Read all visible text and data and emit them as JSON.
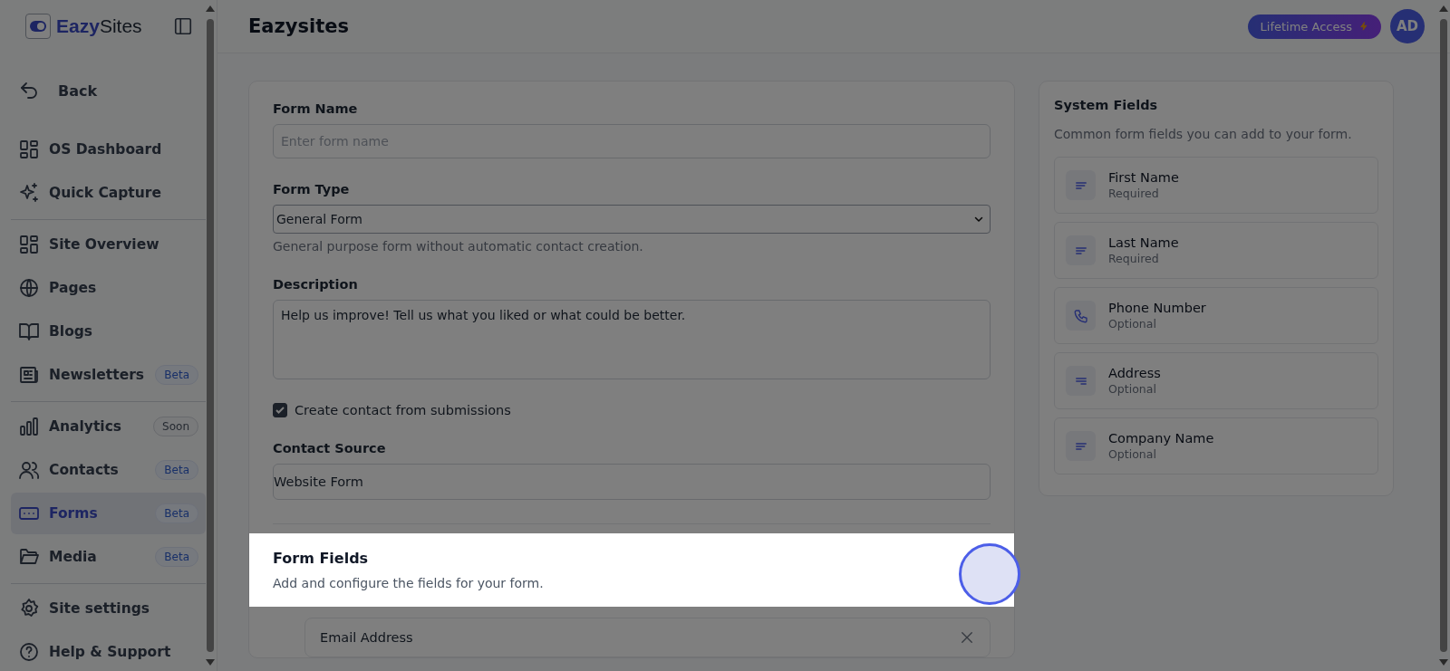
{
  "sidebar": {
    "logo": "**Eazy**Sites",
    "back": "Back",
    "groups": [
      {
        "items": [
          {
            "label": "OS Dashboard",
            "selected": false
          },
          {
            "label": "Quick Capture",
            "selected": false
          }
        ]
      },
      {
        "items": [
          {
            "label": "Site Overview",
            "selected": false
          },
          {
            "label": "Pages",
            "selected": false
          },
          {
            "label": "Blogs",
            "selected": false
          },
          {
            "label": "Newsletters",
            "selected": false,
            "badge": {
              "text": "Beta",
              "kind": "beta"
            }
          }
        ]
      },
      {
        "items": [
          {
            "label": "Analytics",
            "selected": false,
            "badge": {
              "text": "Soon",
              "kind": "soon"
            }
          },
          {
            "label": "Contacts",
            "selected": false,
            "badge": {
              "text": "Beta",
              "kind": "beta"
            }
          },
          {
            "label": "Forms",
            "selected": true,
            "badge": {
              "text": "Beta",
              "kind": "beta"
            }
          },
          {
            "label": "Media",
            "selected": false,
            "badge": {
              "text": "Beta",
              "kind": "beta"
            }
          }
        ]
      },
      {
        "items": [
          {
            "label": "Site settings",
            "selected": false
          },
          {
            "label": "Help & Support",
            "selected": false
          }
        ]
      }
    ]
  },
  "header": {
    "title": "Eazysites",
    "plan": "Lifetime Access",
    "avatar": "AD"
  },
  "form": {
    "name_label": "Form Name",
    "name_placeholder": "Enter form name",
    "type_label": "Form Type",
    "type_value": "General Form",
    "type_hint": "General purpose form without automatic contact creation.",
    "description_label": "Description",
    "description_value": "Help us improve! Tell us what you liked or what could be better.",
    "create_contact": {
      "label": "Create contact from submissions",
      "checked": true
    },
    "source_label": "Contact Source",
    "source_value": "Website Form",
    "fields_title": "Form Fields",
    "fields_subtitle": "Add and configure the fields for your form.",
    "fields": [
      {
        "label": "Email Address"
      }
    ]
  },
  "system_fields": {
    "title": "System Fields",
    "subtitle": "Common form fields you can add to your form.",
    "items": [
      {
        "name": "First Name",
        "requirement": "Required",
        "kind": "text"
      },
      {
        "name": "Last Name",
        "requirement": "Required",
        "kind": "text"
      },
      {
        "name": "Phone Number",
        "requirement": "Optional",
        "kind": "phone"
      },
      {
        "name": "Address",
        "requirement": "Optional",
        "kind": "address"
      },
      {
        "name": "Company Name",
        "requirement": "Optional",
        "kind": "text"
      }
    ]
  },
  "tour": {
    "spotlight": true
  }
}
